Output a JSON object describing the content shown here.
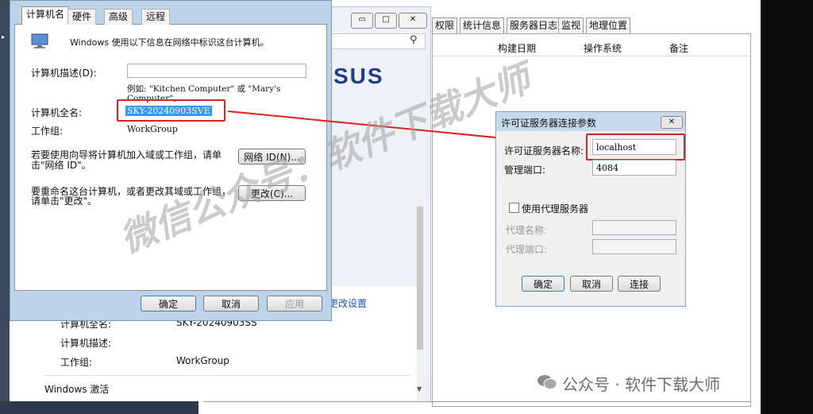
{
  "server_manager": {
    "tabs": [
      "权限",
      "统计信息",
      "服务器日志",
      "监视",
      "地理位置"
    ],
    "columns": [
      "构建日期",
      "操作系统",
      "备注"
    ],
    "window_buttons": [
      "▭",
      "□",
      "✕"
    ],
    "brand_fragment": "SUS"
  },
  "system_panel": {
    "change_settings_link": "更改设置",
    "rows": [
      {
        "label": "计算机全名:",
        "value": "SKY-20240903SS"
      },
      {
        "label": "计算机描述:",
        "value": ""
      },
      {
        "label": "工作组:",
        "value": "WorkGroup"
      }
    ],
    "activation": "Windows 激活"
  },
  "sys_props": {
    "tabs": [
      "计算机名",
      "硬件",
      "高级",
      "远程"
    ],
    "intro": "Windows 使用以下信息在网络中标识这台计算机。",
    "desc_label": "计算机描述(D):",
    "desc_value": "",
    "example_line1": "例如: \"Kitchen Computer\" 或 \"Mary's",
    "example_line2": "Computer\"。",
    "fullname_label": "计算机全名:",
    "fullname_value": "SKY-20240903SVE",
    "workgroup_label": "工作组:",
    "workgroup_value": "WorkGroup",
    "network_text_1": "若要使用向导将计算机加入域或工作组，请单",
    "network_text_2": "击\"网络 ID\"。",
    "network_btn": "网络 ID(N)...",
    "rename_text_1": "要重命名这台计算机，或者更改其域或工作组，",
    "rename_text_2": "请单击\"更改\"。",
    "change_btn": "更改(C)...",
    "ok_btn": "确定",
    "cancel_btn": "取消",
    "apply_btn": "应用"
  },
  "license_dialog": {
    "title": "许可证服务器连接参数",
    "server_label": "许可证服务器名称:",
    "server_value": "localhost",
    "port_label": "管理端口:",
    "port_value": "4084",
    "proxy_checkbox": "使用代理服务器",
    "proxy_name_label": "代理名称:",
    "proxy_port_label": "代理端口:",
    "ok": "确定",
    "cancel": "取消",
    "connect": "连接"
  },
  "watermark": {
    "diagonal": "微信公众号：软件下载大师",
    "footer": "公众号 · 软件下载大师"
  },
  "colors": {
    "highlight_red": "#e02020",
    "selection_blue": "#3399ff",
    "dark_panel": "#0c0c0c"
  }
}
